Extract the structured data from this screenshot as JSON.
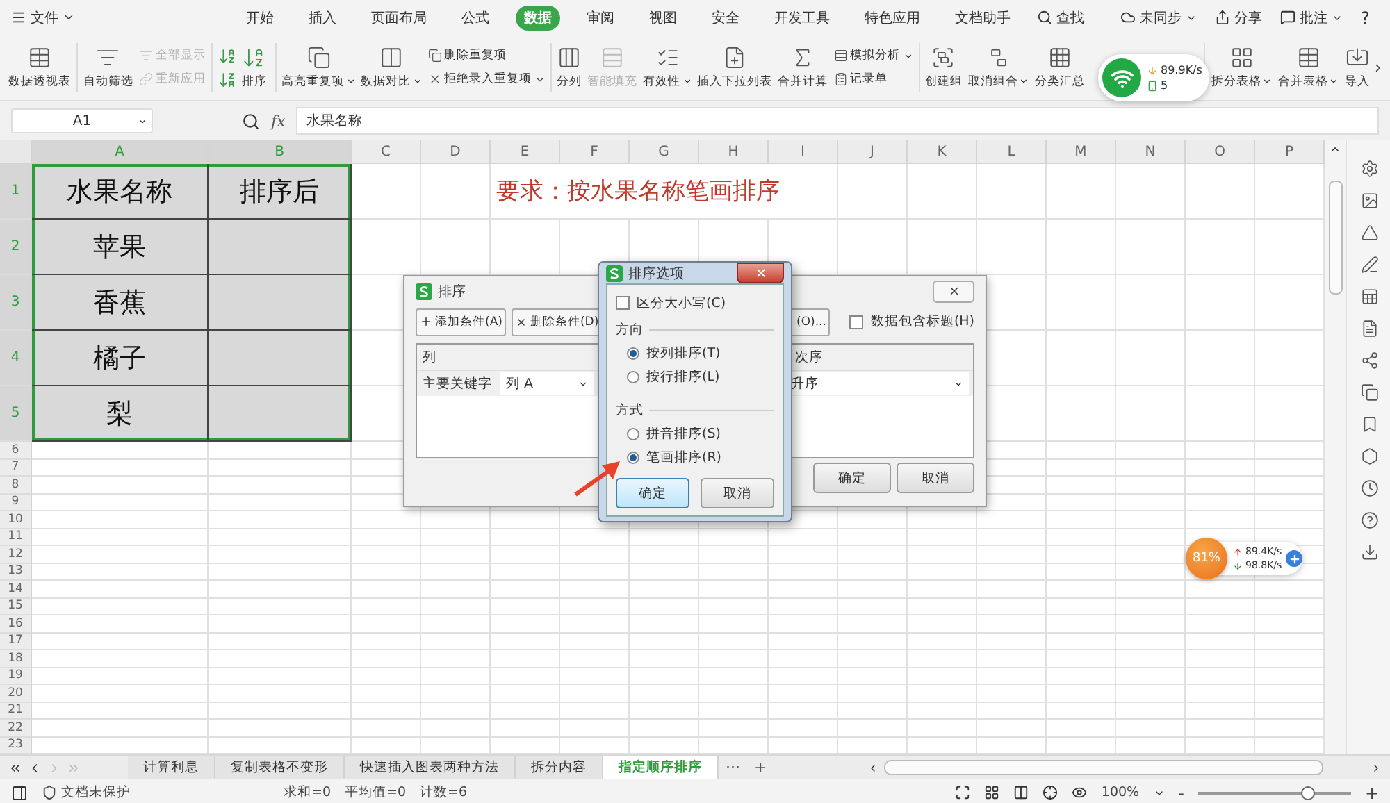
{
  "menu_bar": {
    "file_menu": "文件",
    "tabs": [
      {
        "label": "开始",
        "selected": false
      },
      {
        "label": "插入",
        "selected": false
      },
      {
        "label": "页面布局",
        "selected": false
      },
      {
        "label": "公式",
        "selected": false
      },
      {
        "label": "数据",
        "selected": true
      },
      {
        "label": "审阅",
        "selected": false
      },
      {
        "label": "视图",
        "selected": false
      },
      {
        "label": "安全",
        "selected": false
      },
      {
        "label": "开发工具",
        "selected": false
      },
      {
        "label": "特色应用",
        "selected": false
      },
      {
        "label": "文档助手",
        "selected": false
      }
    ],
    "search": "查找",
    "sync": "未同步",
    "share": "分享",
    "comment": "批注",
    "help": "?"
  },
  "ribbon": [
    {
      "kind": "large",
      "label": "数据透视表",
      "disabled": false,
      "dropdown": false,
      "group_end": true
    },
    {
      "kind": "large",
      "label": "自动筛选",
      "disabled": false,
      "dropdown": false,
      "group_end": false
    },
    {
      "kind": "stack",
      "items": [
        {
          "label": "全部显示",
          "disabled": true,
          "dropdown": false
        },
        {
          "label": "重新应用",
          "disabled": true,
          "dropdown": false
        }
      ],
      "group_end": true
    },
    {
      "kind": "sort",
      "label": "排序",
      "disabled": false,
      "dropdown": false,
      "group_end": true
    },
    {
      "kind": "large",
      "label": "高亮重复项",
      "disabled": false,
      "dropdown": true,
      "group_end": false
    },
    {
      "kind": "large",
      "label": "数据对比",
      "disabled": false,
      "dropdown": true,
      "group_end": false
    },
    {
      "kind": "stack",
      "items": [
        {
          "label": "删除重复项",
          "disabled": false,
          "dropdown": false
        },
        {
          "label": "拒绝录入重复项",
          "disabled": false,
          "dropdown": true
        }
      ],
      "group_end": true
    },
    {
      "kind": "large",
      "label": "分列",
      "disabled": false,
      "dropdown": false,
      "group_end": false
    },
    {
      "kind": "large",
      "label": "智能填充",
      "disabled": true,
      "dropdown": false,
      "group_end": false
    },
    {
      "kind": "large",
      "label": "有效性",
      "disabled": false,
      "dropdown": true,
      "group_end": false
    },
    {
      "kind": "large",
      "label": "插入下拉列表",
      "disabled": false,
      "dropdown": false,
      "group_end": false
    },
    {
      "kind": "large",
      "label": "合并计算",
      "disabled": false,
      "dropdown": false,
      "group_end": false
    },
    {
      "kind": "stack",
      "items": [
        {
          "label": "模拟分析",
          "disabled": false,
          "dropdown": true
        },
        {
          "label": "记录单",
          "disabled": false,
          "dropdown": false
        }
      ],
      "group_end": true
    },
    {
      "kind": "large",
      "label": "创建组",
      "disabled": false,
      "dropdown": false,
      "group_end": false
    },
    {
      "kind": "large",
      "label": "取消组合",
      "disabled": false,
      "dropdown": true,
      "group_end": false
    },
    {
      "kind": "large",
      "label": "分类汇总",
      "disabled": false,
      "dropdown": false,
      "group_end": true
    },
    {
      "kind": "large",
      "label": "拆分表格",
      "disabled": false,
      "dropdown": true,
      "group_end": false
    },
    {
      "kind": "large",
      "label": "合并表格",
      "disabled": false,
      "dropdown": true,
      "group_end": false
    },
    {
      "kind": "large",
      "label": "导入",
      "disabled": false,
      "dropdown": false,
      "group_end": false
    }
  ],
  "formula_bar": {
    "cell_ref": "A1",
    "fx_label": "fx",
    "formula": "水果名称"
  },
  "sheet": {
    "columns": [
      {
        "label": "A",
        "selected": true
      },
      {
        "label": "B",
        "selected": true
      },
      {
        "label": "C",
        "selected": false
      },
      {
        "label": "D",
        "selected": false
      },
      {
        "label": "E",
        "selected": false
      },
      {
        "label": "F",
        "selected": false
      },
      {
        "label": "G",
        "selected": false
      },
      {
        "label": "H",
        "selected": false
      },
      {
        "label": "I",
        "selected": false
      },
      {
        "label": "J",
        "selected": false
      },
      {
        "label": "K",
        "selected": false
      },
      {
        "label": "L",
        "selected": false
      },
      {
        "label": "M",
        "selected": false
      },
      {
        "label": "N",
        "selected": false
      },
      {
        "label": "O",
        "selected": false
      },
      {
        "label": "P",
        "selected": false
      }
    ],
    "rows": [
      {
        "label": "1",
        "selected": true,
        "shaded": true,
        "cells": [
          "水果名称",
          "排序后"
        ],
        "note": "要求：按水果名称笔画排序"
      },
      {
        "label": "2",
        "selected": true,
        "shaded": true,
        "cells": [
          "苹果"
        ]
      },
      {
        "label": "3",
        "selected": true,
        "shaded": true,
        "cells": [
          "香蕉"
        ]
      },
      {
        "label": "4",
        "selected": true,
        "shaded": true,
        "cells": [
          "橘子"
        ]
      },
      {
        "label": "5",
        "selected": true,
        "shaded": true,
        "cells": [
          "梨"
        ]
      },
      {
        "label": "6",
        "selected": false,
        "shaded": false
      },
      {
        "label": "7",
        "selected": false,
        "shaded": false
      },
      {
        "label": "8",
        "selected": false,
        "shaded": false
      },
      {
        "label": "9",
        "selected": false,
        "shaded": false
      },
      {
        "label": "10",
        "selected": false,
        "shaded": false
      },
      {
        "label": "11",
        "selected": false,
        "shaded": false
      },
      {
        "label": "12",
        "selected": false,
        "shaded": false
      },
      {
        "label": "13",
        "selected": false,
        "shaded": false
      },
      {
        "label": "14",
        "selected": false,
        "shaded": false
      },
      {
        "label": "15",
        "selected": false,
        "shaded": false
      },
      {
        "label": "16",
        "selected": false,
        "shaded": false
      },
      {
        "label": "17",
        "selected": false,
        "shaded": false
      },
      {
        "label": "18",
        "selected": false,
        "shaded": false
      },
      {
        "label": "19",
        "selected": false,
        "shaded": false
      },
      {
        "label": "20",
        "selected": false,
        "shaded": false
      },
      {
        "label": "21",
        "selected": false,
        "shaded": false
      },
      {
        "label": "22",
        "selected": false,
        "shaded": false
      },
      {
        "label": "23",
        "selected": false,
        "shaded": false
      }
    ]
  },
  "sort_dialog": {
    "title": "排序",
    "add_condition": "添加条件(A)",
    "delete_condition": "删除条件(D)",
    "options_button": "(O)...",
    "header_checkbox": {
      "label": "数据包含标题(H)",
      "checked": false
    },
    "columns": [
      "列",
      "次序"
    ],
    "key_label": "主要关键字",
    "key_value": "列 A",
    "order_value": "升序",
    "ok": "确定",
    "cancel": "取消"
  },
  "options_dialog": {
    "title": "排序选项",
    "case_checkbox": {
      "label": "区分大小写(C)",
      "checked": false
    },
    "direction_title": "方向",
    "direction": [
      {
        "label": "按列排序(T)",
        "selected": true
      },
      {
        "label": "按行排序(L)",
        "selected": false
      }
    ],
    "method_title": "方式",
    "method": [
      {
        "label": "拼音排序(S)",
        "selected": false
      },
      {
        "label": "笔画排序(R)",
        "selected": true
      }
    ],
    "ok": "确定",
    "cancel": "取消"
  },
  "network_widget": {
    "speed": "89.9K/s",
    "count": "5"
  },
  "speed_widget": {
    "percent": "81%",
    "upload": "89.4K/s",
    "download": "98.8K/s"
  },
  "sheet_tabs": {
    "tabs": [
      {
        "label": "计算利息",
        "selected": false
      },
      {
        "label": "复制表格不变形",
        "selected": false
      },
      {
        "label": "快速插入图表两种方法",
        "selected": false
      },
      {
        "label": "拆分内容",
        "selected": false
      },
      {
        "label": "指定顺序排序",
        "selected": true
      }
    ],
    "more": "···",
    "add": "+"
  },
  "status_bar": {
    "protection": "文档未保护",
    "stats": [
      "求和=0",
      "平均值=0",
      "计数=6"
    ],
    "zoom": "100%",
    "zoom_out": "-",
    "zoom_in": "+",
    "zoom_slider": {
      "level": 0.72
    }
  }
}
